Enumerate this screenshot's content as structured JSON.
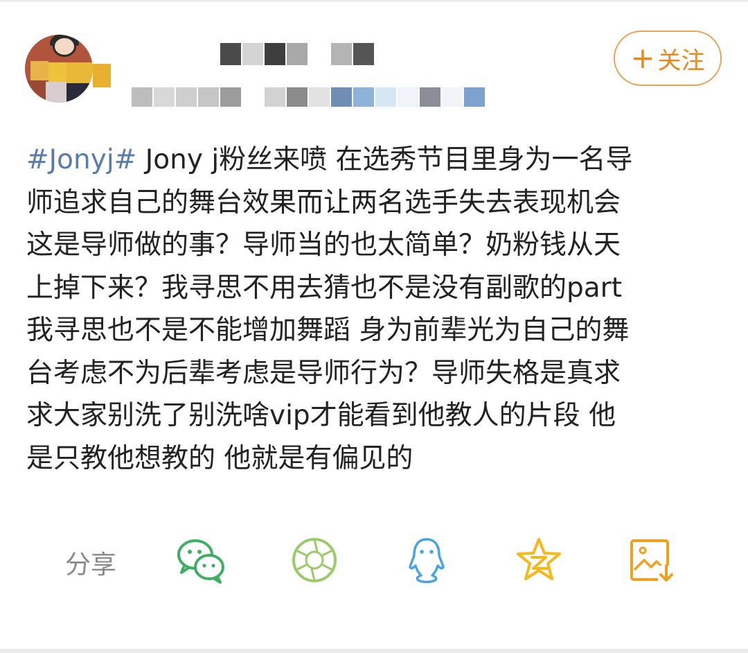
{
  "header": {
    "follow_label": "关注",
    "follow_plus": "+"
  },
  "post": {
    "hashtag": "#Jonyj#",
    "lines": [
      " Jony j粉丝来喷 在选秀节目里身为一名导",
      "师追求自己的舞台效果而让两名选手失去表现机会",
      "这是导师做的事？导师当的也太简单？奶粉钱从天",
      "上掉下来？我寻思不用去猜也不是没有副歌的part",
      "我寻思也不是不能增加舞蹈 身为前辈光为自己的舞",
      "台考虑不为后辈考虑是导师行为？导师失格是真求",
      "求大家别洗了别洗啥vip才能看到他教人的片段 他",
      "是只教他想教的 他就是有偏见的"
    ]
  },
  "share": {
    "label": "分享",
    "targets": [
      {
        "icon": "wechat-icon",
        "color": "#3fae63"
      },
      {
        "icon": "moments-icon",
        "color": "#9cc96b"
      },
      {
        "icon": "qq-icon",
        "color": "#4aa3df"
      },
      {
        "icon": "qzone-icon",
        "color": "#f4b81c"
      },
      {
        "icon": "save-image-icon",
        "color": "#f0a020"
      }
    ]
  },
  "colors": {
    "hashtag": "#5b7ba8",
    "text": "#222222",
    "follow_accent": "#e8871e"
  }
}
